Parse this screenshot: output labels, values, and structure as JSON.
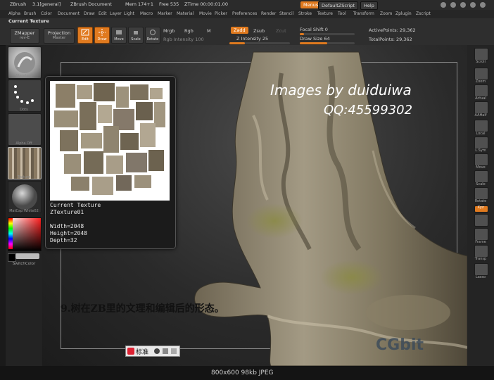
{
  "titlebar": {
    "app": "ZBrush",
    "version": "3.1[general]",
    "document": "ZBrush Document",
    "mem": "Mem 174+1",
    "free": "Free 535",
    "ztime": "ZTime 00:00:01.00",
    "menus_btn": "Menus",
    "default_script": "DefaultZScript",
    "help": "Help"
  },
  "menubar": {
    "items": [
      "Alpha",
      "Brush",
      "Color",
      "Document",
      "Draw",
      "Edit",
      "Layer",
      "Light",
      "Macro",
      "Marker",
      "Material",
      "Movie",
      "Picker",
      "Preferences",
      "Render",
      "Stencil",
      "Stroke",
      "Texture",
      "Tool",
      "Transform",
      "Zoom",
      "Zplugin",
      "Zscript"
    ]
  },
  "toolbar": {
    "current_texture_label": "Current Texture",
    "zmapper": "ZMapper",
    "zmapper_sub": "rev-E",
    "projection": "Projection",
    "projection_sub": "Master",
    "edit": "Edit",
    "draw": "Draw",
    "move": "Move",
    "scale": "Scale",
    "rotate": "Rotate",
    "mrgb": "Mrgb",
    "rgb": "Rgb",
    "m": "M",
    "rgb_intensity": "Rgb Intensity 100",
    "zadd": "Zadd",
    "zsub": "Zsub",
    "zcut": "Zcut",
    "z_intensity": "Z Intensity 25",
    "focal_shift": "Focal Shift 0",
    "draw_size": "Draw Size 64",
    "active_points": "ActivePoints: 29,362",
    "total_points": "TotalPoints: 29,362",
    "sliders": {
      "rgb_intensity": 100,
      "z_intensity": 25,
      "focal_shift": 0,
      "draw_size": 64
    }
  },
  "leftpanel": {
    "standard": "Standard",
    "dots": "Dots",
    "alpha_off": "Alpha Off",
    "texture": "Texture",
    "matcap": "MatCap White02",
    "switch_color": "SwitchColor"
  },
  "popup": {
    "title": "Current Texture",
    "name": "ZTexture01",
    "width": "Width=2048",
    "height": "Height=2048",
    "depth": "Depth=32"
  },
  "canvas": {
    "watermark1": "Images by duiduiwa",
    "watermark2": "QQ:45599302",
    "caption": "9.树在ZB里的文理和编辑后的形态。",
    "ime": "标准",
    "corner_logo": "CGbit"
  },
  "rightpanel": {
    "items": [
      "Scroll",
      "Zoom",
      "Actual",
      "AAHalf",
      "Local",
      "L.Sym",
      "Move",
      "Scale",
      "Rotate",
      "Xyz",
      "",
      "Frame",
      "Transp",
      "Lasso"
    ]
  },
  "statusbar": {
    "info": "800x600  98kb  JPEG"
  },
  "colors": {
    "accent": "#e07a1f",
    "bg": "#1a1a1a",
    "panel": "#2e2e2e"
  }
}
